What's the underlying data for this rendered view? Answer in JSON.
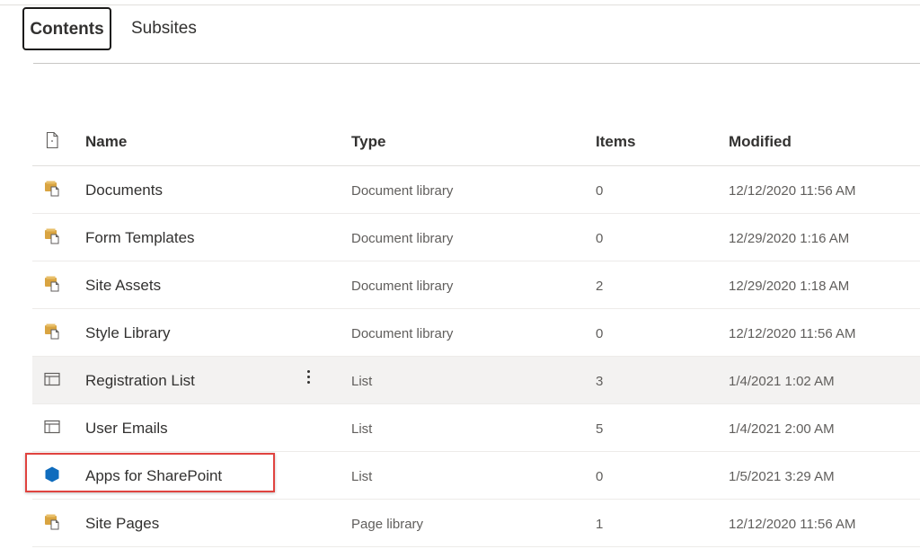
{
  "tabs": {
    "contents": "Contents",
    "subsites": "Subsites"
  },
  "table": {
    "headers": {
      "file_icon": "file-icon",
      "name": "Name",
      "type": "Type",
      "items": "Items",
      "modified": "Modified"
    },
    "rows": [
      {
        "icon": "document-library-icon",
        "name": "Documents",
        "type": "Document library",
        "items": "0",
        "modified": "12/12/2020 11:56 AM"
      },
      {
        "icon": "document-library-icon",
        "name": "Form Templates",
        "type": "Document library",
        "items": "0",
        "modified": "12/29/2020 1:16 AM"
      },
      {
        "icon": "document-library-icon",
        "name": "Site Assets",
        "type": "Document library",
        "items": "2",
        "modified": "12/29/2020 1:18 AM"
      },
      {
        "icon": "document-library-icon",
        "name": "Style Library",
        "type": "Document library",
        "items": "0",
        "modified": "12/12/2020 11:56 AM"
      },
      {
        "icon": "list-icon",
        "name": "Registration List",
        "type": "List",
        "items": "3",
        "modified": "1/4/2021 1:02 AM",
        "selected": true
      },
      {
        "icon": "list-icon",
        "name": "User Emails",
        "type": "List",
        "items": "5",
        "modified": "1/4/2021 2:00 AM"
      },
      {
        "icon": "app-hexagon-icon",
        "name": "Apps for SharePoint",
        "type": "List",
        "items": "0",
        "modified": "1/5/2021 3:29 AM",
        "highlighted": true
      },
      {
        "icon": "document-library-icon",
        "name": "Site Pages",
        "type": "Page library",
        "items": "1",
        "modified": "12/12/2020 11:56 AM"
      }
    ]
  },
  "colors": {
    "highlight_border": "#e0433f",
    "library_icon": "#d9a441",
    "app_icon": "#0f6cbd",
    "selected_row": "#f3f2f1"
  }
}
